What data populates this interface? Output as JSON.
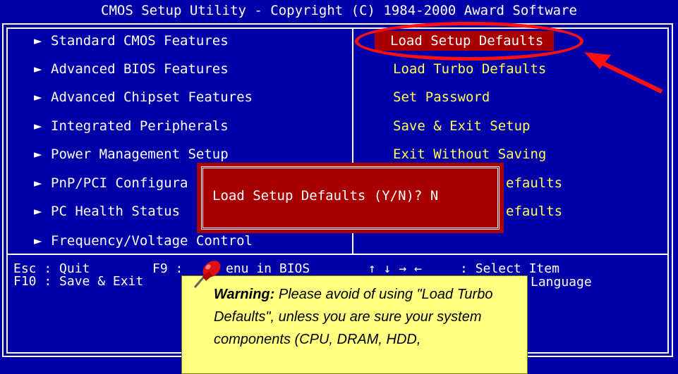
{
  "title": "CMOS Setup Utility - Copyright (C) 1984-2000 Award Software",
  "left_menu": [
    {
      "label": "Standard CMOS Features"
    },
    {
      "label": "Advanced BIOS Features"
    },
    {
      "label": "Advanced Chipset Features"
    },
    {
      "label": "Integrated Peripherals"
    },
    {
      "label": "Power Management Setup"
    },
    {
      "label": "PnP/PCI Configura"
    },
    {
      "label": "PC Health Status"
    },
    {
      "label": "Frequency/Voltage Control"
    }
  ],
  "right_menu": [
    {
      "label": "Load Setup Defaults"
    },
    {
      "label": "Load Turbo Defaults"
    },
    {
      "label": "Set Password"
    },
    {
      "label": "Save & Exit Setup"
    },
    {
      "label": "Exit Without Saving"
    },
    {
      "label": "efaults"
    },
    {
      "label": "efaults"
    }
  ],
  "dialog": {
    "prompt": "Load Setup Defaults (Y/N)? N"
  },
  "help": {
    "esc": "Esc : Quit",
    "f9": "F9 :",
    "f9_rest": "enu in BIOS",
    "f10": "F10 : Save & Exit",
    "select": "↑ ↓ → ←     : Select Item",
    "language": "Language"
  },
  "note": {
    "heading": "Warning:",
    "body": "Please avoid of using \"Load Turbo Defaults\", unless you are sure your system components (CPU, DRAM, HDD,"
  },
  "colors": {
    "background": "#0000a8",
    "selected": "#a80000",
    "option_text": "#ffff55",
    "annotation": "#ff1010",
    "note_bg": "#ffff80"
  }
}
